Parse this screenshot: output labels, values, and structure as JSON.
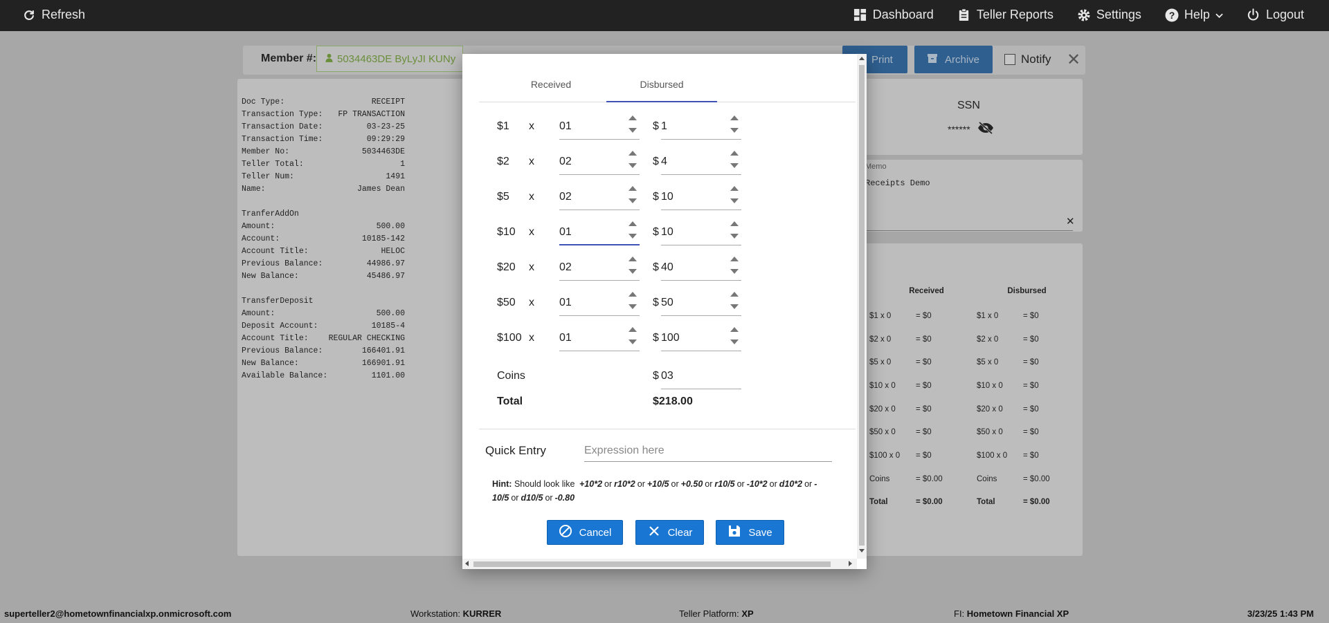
{
  "topbar": {
    "refresh": "Refresh",
    "nav": [
      {
        "label": "Dashboard",
        "icon": "dashboard-icon"
      },
      {
        "label": "Teller Reports",
        "icon": "clipboard-icon"
      },
      {
        "label": "Settings",
        "icon": "gear-icon"
      },
      {
        "label": "Help",
        "icon": "help-icon"
      },
      {
        "label": "Logout",
        "icon": "power-icon"
      }
    ]
  },
  "member": {
    "label": "Member #:",
    "value": "5034463DE ByLyJI KUNy",
    "print": "Print",
    "archive": "Archive",
    "notify": "Notify"
  },
  "receipt": {
    "rows": [
      [
        "Doc Type:",
        "RECEIPT"
      ],
      [
        "Transaction Type:",
        "FP TRANSACTION"
      ],
      [
        "Transaction Date:",
        "03-23-25"
      ],
      [
        "Transaction Time:",
        "09:29:29"
      ],
      [
        "Member No:",
        "5034463DE"
      ],
      [
        "Teller Total:",
        "1"
      ],
      [
        "Teller Num:",
        "1491"
      ],
      [
        "Name:",
        "James Dean"
      ]
    ],
    "section1_title": "TranferAddOn",
    "section1": [
      [
        "Amount:",
        "500.00"
      ],
      [
        "Account:",
        "10185-142"
      ],
      [
        "Account Title:",
        "HELOC"
      ],
      [
        "Previous Balance:",
        "44986.97"
      ],
      [
        "New Balance:",
        "45486.97"
      ]
    ],
    "section2_title": "TransferDeposit",
    "section2": [
      [
        "Amount:",
        "500.00"
      ],
      [
        "Deposit Account:",
        "10185-4"
      ],
      [
        "Account Title:",
        "REGULAR CHECKING"
      ],
      [
        "Previous Balance:",
        "166401.91"
      ],
      [
        "New Balance:",
        "166901.91"
      ],
      [
        "Available Balance:",
        "1101.00"
      ]
    ]
  },
  "ssn": {
    "title": "SSN",
    "masked": "******"
  },
  "memo": {
    "label": "Memo",
    "text": "Receipts Demo"
  },
  "counts": {
    "received_header": "Received",
    "disbursed_header": "Disbursed",
    "rows": [
      [
        "$1 x 0",
        "= $0",
        "$1 x 0",
        "= $0"
      ],
      [
        "$2 x 0",
        "= $0",
        "$2 x 0",
        "= $0"
      ],
      [
        "$5 x 0",
        "= $0",
        "$5 x 0",
        "= $0"
      ],
      [
        "$10 x 0",
        "= $0",
        "$10 x 0",
        "= $0"
      ],
      [
        "$20 x 0",
        "= $0",
        "$20 x 0",
        "= $0"
      ],
      [
        "$50 x 0",
        "= $0",
        "$50 x 0",
        "= $0"
      ],
      [
        "$100 x 0",
        "= $0",
        "$100 x 0",
        "= $0"
      ],
      [
        "Coins",
        "= $0.00",
        "Coins",
        "= $0.00"
      ],
      [
        "Total",
        "= $0.00",
        "Total",
        "= $0.00"
      ]
    ]
  },
  "modal": {
    "tabs": [
      "Received",
      "Disbursed"
    ],
    "active_tab": 1,
    "mult": "x",
    "currency": "$",
    "denoms": [
      {
        "label": "$1",
        "qty": "01",
        "amount": "1"
      },
      {
        "label": "$2",
        "qty": "02",
        "amount": "4"
      },
      {
        "label": "$5",
        "qty": "02",
        "amount": "10"
      },
      {
        "label": "$10",
        "qty": "01",
        "amount": "10"
      },
      {
        "label": "$20",
        "qty": "02",
        "amount": "40"
      },
      {
        "label": "$50",
        "qty": "01",
        "amount": "50"
      },
      {
        "label": "$100",
        "qty": "01",
        "amount": "100"
      }
    ],
    "coins_label": "Coins",
    "coins_value": "03",
    "total_label": "Total",
    "total_value": "$218.00",
    "quick_entry_label": "Quick Entry",
    "quick_entry_placeholder": "Expression here",
    "hint_label": "Hint:",
    "hint_text": "Should look like",
    "hint_examples": [
      "+10*2",
      "r10*2",
      "+10/5",
      "+0.50",
      "r10/5",
      "-10*2",
      "d10*2",
      "-10/5",
      "d10/5",
      "-0.80"
    ],
    "hint_or": "or",
    "cancel": "Cancel",
    "clear": "Clear",
    "save": "Save"
  },
  "footer": {
    "user": "superteller2@hometownfinancialxp.onmicrosoft.com",
    "workstation_label": "Workstation:",
    "workstation": "KURRER",
    "platform_label": "Teller Platform:",
    "platform": "XP",
    "fi_label": "FI:",
    "fi": "Hometown Financial XP",
    "datetime": "3/23/25 1:43 PM"
  },
  "colors": {
    "primary": "#1976d2",
    "topbar": "#222222",
    "tab_indicator": "#3f51b5"
  }
}
